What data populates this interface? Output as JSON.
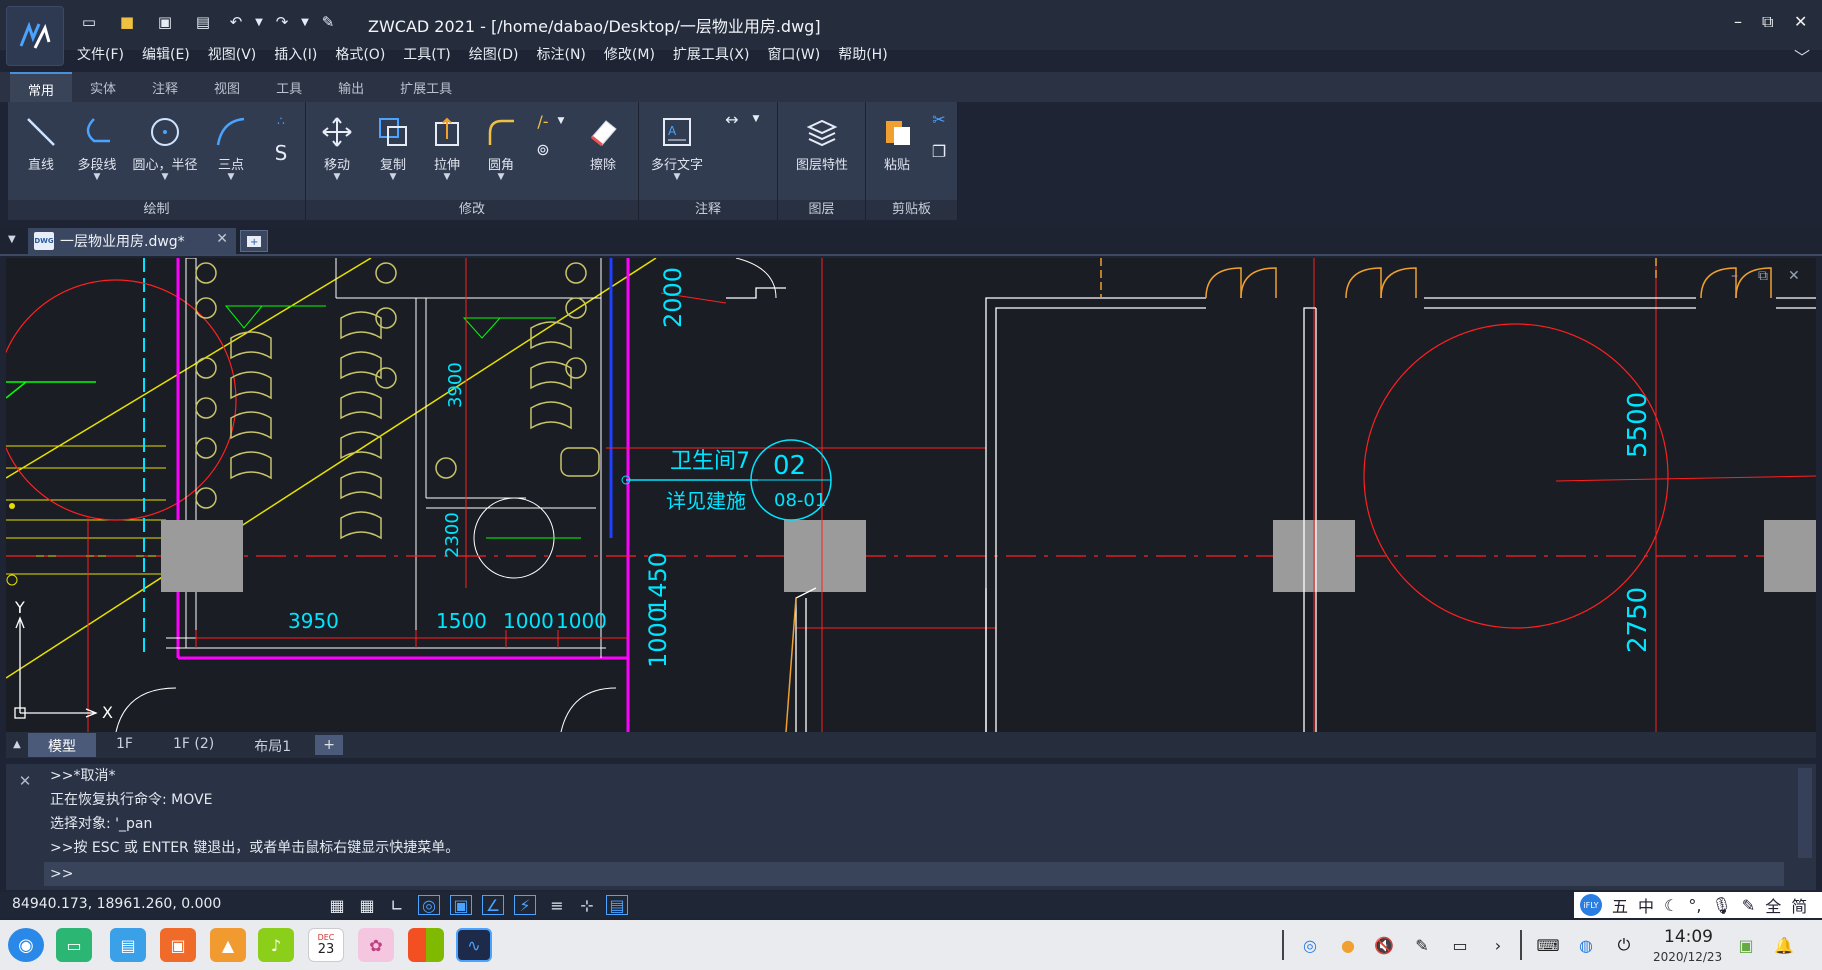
{
  "window": {
    "title": "ZWCAD 2021 - [/home/dabao/Desktop/一层物业用房.dwg]",
    "controls": [
      "–",
      "⧉",
      "✕"
    ]
  },
  "menu": [
    "文件(F)",
    "编辑(E)",
    "视图(V)",
    "插入(I)",
    "格式(O)",
    "工具(T)",
    "绘图(D)",
    "标注(N)",
    "修改(M)",
    "扩展工具(X)",
    "窗口(W)",
    "帮助(H)"
  ],
  "ribbon_tabs": [
    "常用",
    "实体",
    "注释",
    "视图",
    "工具",
    "输出",
    "扩展工具"
  ],
  "ribbon": {
    "draw": {
      "title": "绘制",
      "line": "直线",
      "polyline": "多段线",
      "circle": "圆心，半径",
      "arc": "三点"
    },
    "modify": {
      "title": "修改",
      "move": "移动",
      "copy": "复制",
      "stretch": "拉伸",
      "fillet": "圆角",
      "erase": "擦除"
    },
    "annotate": {
      "title": "注释",
      "mtext": "多行文字"
    },
    "layers": {
      "title": "图层",
      "props": "图层特性"
    },
    "clipboard": {
      "title": "剪贴板",
      "paste": "粘贴"
    }
  },
  "doc_tab": {
    "label": "一层物业用房.dwg*",
    "icon": "DWG"
  },
  "drawing": {
    "dims": {
      "d3950": "3950",
      "d1500": "1500",
      "d1000a": "1000",
      "d1000b": "1000",
      "d3900": "3900",
      "d2300": "2300",
      "d1450": "1450",
      "d1000v": "1000",
      "d2000": "2000",
      "d5500": "5500",
      "d2750": "2750"
    },
    "room_label": "卫生间7",
    "see_label": "详见建施",
    "tag_num": "02",
    "tag_sheet": "08-01",
    "ucs_y": "Y",
    "ucs_x": "X"
  },
  "layout_tabs": [
    "模型",
    "1F",
    "1F (2)",
    "布局1"
  ],
  "command": {
    "lines": [
      ">>*取消*",
      "正在恢复执行命令: MOVE",
      "选择对象: '_pan",
      ">>按 ESC 或 ENTER 键退出，或者单击鼠标右键显示快捷菜单。"
    ],
    "prompt": ">>"
  },
  "status": {
    "coords": "84940.173, 18961.260, 0.000"
  },
  "ime": [
    "五",
    "中",
    "全",
    "简"
  ],
  "clock": {
    "time": "14:09",
    "date": "2020/12/23"
  },
  "calendar_icon": {
    "month": "DEC",
    "day": "23"
  },
  "colors": {
    "accent": "#4a90d9",
    "cad_red": "#ff2020",
    "cad_yellow": "#e6e000",
    "cad_cyan": "#00e5ff",
    "cad_magenta": "#ff00ff",
    "cad_green": "#00ff00",
    "cad_white": "#ffffff",
    "cad_olive": "#c8c46a"
  }
}
